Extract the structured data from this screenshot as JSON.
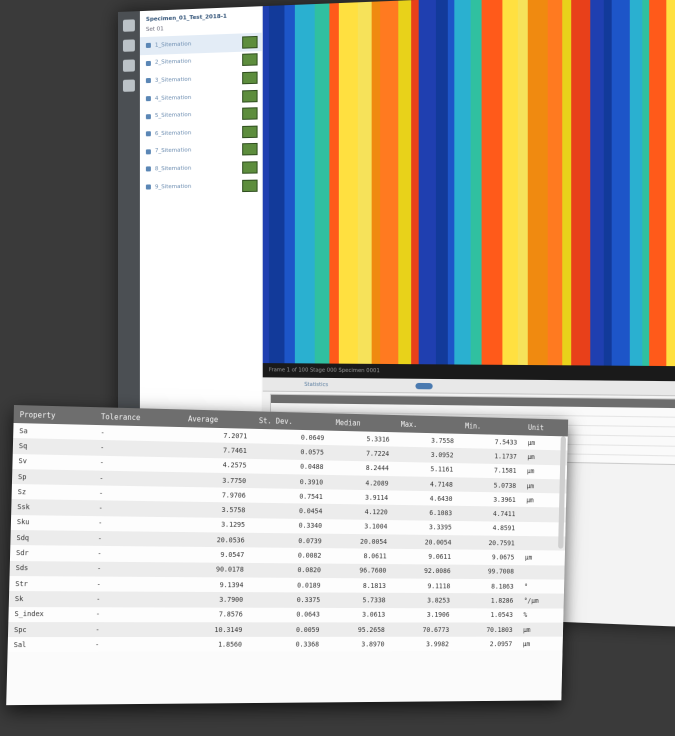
{
  "tree": {
    "title": "Specimen_01_Test_2018-1",
    "subtitle": "Set 01",
    "items": [
      {
        "label": "1_Sitemation",
        "selected": true
      },
      {
        "label": "2_Sitemation"
      },
      {
        "label": "3_Sitemation"
      },
      {
        "label": "4_Sitemation"
      },
      {
        "label": "5_Sitemation"
      },
      {
        "label": "6_Sitemation"
      },
      {
        "label": "7_Sitemation"
      },
      {
        "label": "8_Sitemation"
      },
      {
        "label": "9_Sitemation"
      }
    ]
  },
  "viewer": {
    "status": "Frame 1 of 100   Stage 000   Specimen 0001",
    "tab_label": "Statistics"
  },
  "table": {
    "headers": [
      "Property",
      "Tolerance",
      "Average",
      "St. Dev.",
      "Median",
      "Max.",
      "Min.",
      "Unit"
    ],
    "rows": [
      [
        "Sa",
        "-",
        "7.2071",
        "0.0649",
        "5.3316",
        "3.7558",
        "7.5433",
        "µm"
      ],
      [
        "Sq",
        "-",
        "7.7461",
        "0.0575",
        "7.7224",
        "3.0952",
        "1.1737",
        "µm"
      ],
      [
        "Sv",
        "-",
        "4.2575",
        "0.0488",
        "8.2444",
        "5.1161",
        "7.1581",
        "µm"
      ],
      [
        "Sp",
        "-",
        "3.7750",
        "0.3910",
        "4.2089",
        "4.7148",
        "5.0738",
        "µm"
      ],
      [
        "Sz",
        "-",
        "7.9706",
        "0.7541",
        "3.9114",
        "4.6430",
        "3.3961",
        "µm"
      ],
      [
        "Ssk",
        "-",
        "3.5758",
        "0.0454",
        "4.1220",
        "6.1083",
        "4.7411",
        ""
      ],
      [
        "Sku",
        "-",
        "3.1295",
        "0.3340",
        "3.1004",
        "3.3395",
        "4.8591",
        ""
      ],
      [
        "Sdq",
        "-",
        "20.0536",
        "0.0739",
        "20.0054",
        "20.0054",
        "20.7591",
        ""
      ],
      [
        "Sdr",
        "-",
        "9.0547",
        "0.0082",
        "8.0611",
        "9.0611",
        "9.0675",
        "µm"
      ],
      [
        "Sds",
        "-",
        "90.0178",
        "0.0820",
        "96.7600",
        "92.0086",
        "99.7008",
        ""
      ],
      [
        "Str",
        "-",
        "9.1394",
        "0.0189",
        "8.1813",
        "9.1118",
        "8.1863",
        "°"
      ],
      [
        "Sk",
        "-",
        "3.7900",
        "0.3375",
        "5.7338",
        "3.8253",
        "1.8286",
        "°/µm"
      ],
      [
        "S_index",
        "-",
        "7.8576",
        "0.0643",
        "3.0613",
        "3.1906",
        "1.0543",
        "%"
      ],
      [
        "Spc",
        "-",
        "10.3149",
        "0.0059",
        "95.2658",
        "70.6773",
        "70.1803",
        "µm"
      ],
      [
        "Sal",
        "-",
        "1.8560",
        "0.3368",
        "3.8970",
        "3.9982",
        "2.0957",
        "µm"
      ]
    ]
  },
  "colors": {
    "background": "#3a3a3a",
    "header": "#6e6e6e",
    "accent": "#4a7ab0"
  }
}
